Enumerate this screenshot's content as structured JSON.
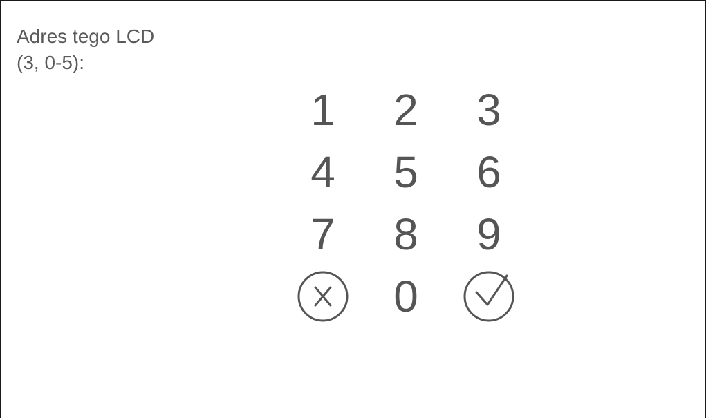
{
  "prompt": {
    "line1": "Adres tego LCD",
    "line2": "(3, 0-5):"
  },
  "keypad": {
    "keys": [
      "1",
      "2",
      "3",
      "4",
      "5",
      "6",
      "7",
      "8",
      "9"
    ],
    "zero": "0",
    "cancel_icon": "circle-x-icon",
    "confirm_icon": "circle-check-icon"
  },
  "colors": {
    "text": "#555555",
    "border": "#1a1a1a",
    "background": "#ffffff"
  }
}
